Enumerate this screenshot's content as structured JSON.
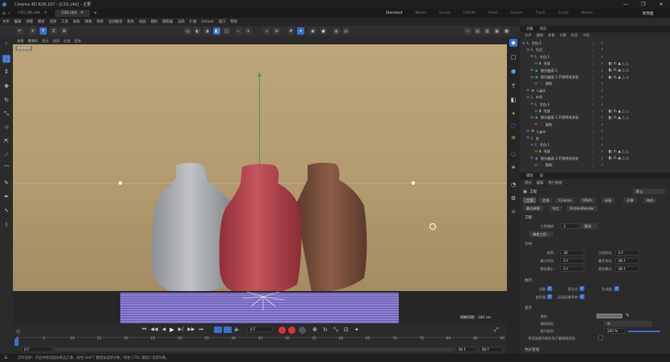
{
  "app": {
    "title": "Cinema 4D R26.107 - [C02.c4d] - 主要"
  },
  "doc_tabs": [
    {
      "label": "C05_Q6.c4d",
      "active": false
    },
    {
      "label": "C02.c4d",
      "active": true
    }
  ],
  "layouts": [
    "Standard",
    "Model",
    "Sculpt",
    "UVEdit",
    "Paint",
    "Groom",
    "Track",
    "Script",
    "Nodes"
  ],
  "active_layout": "Standard",
  "new_layout_label": "新界面",
  "menu": [
    "文件",
    "编辑",
    "创建",
    "模式",
    "选择",
    "工具",
    "样条",
    "网格",
    "体积",
    "运动图形",
    "角色",
    "动画",
    "模拟",
    "跟踪器",
    "渲染",
    "扩展",
    "Octane",
    "窗口",
    "帮助"
  ],
  "viewport_menu": [
    "查看",
    "摄像机",
    "显示",
    "选项",
    "过滤",
    "面板"
  ],
  "viewport_label": "透视视图",
  "viewport_status": "网格间距：100 cm",
  "timeline": {
    "ticks": [
      "0",
      "5",
      "10",
      "15",
      "20",
      "25",
      "30",
      "35",
      "40",
      "45",
      "50",
      "55",
      "60",
      "65",
      "70",
      "75",
      "80",
      "85",
      "90"
    ],
    "current_frame": "0 F",
    "start_frame": "0 F",
    "end_frame_a": "90 F",
    "end_frame_b": "90 F",
    "frame_counter": "0 F"
  },
  "status_text": "实时选择：点击并拖动鼠标框选元素。按住 SHIFT 键增加选择对象；按住 CTRL 键减少选择对象。",
  "object_manager": {
    "tabs": [
      "对象",
      "场次"
    ],
    "menu": [
      "文件",
      "编辑",
      "查看",
      "对象",
      "标签",
      "书签"
    ],
    "rows": [
      {
        "indent": 0,
        "name": "空白.1",
        "icon": "null"
      },
      {
        "indent": 1,
        "name": "左边",
        "icon": "null"
      },
      {
        "indent": 2,
        "name": "空白.1",
        "icon": "null"
      },
      {
        "indent": 3,
        "name": "毛皮",
        "icon": "fur"
      },
      {
        "indent": 2,
        "name": "细分曲面.1",
        "icon": "subdiv"
      },
      {
        "indent": 2,
        "name": "细分曲面.1.不透明毛发贴",
        "icon": "subdiv"
      },
      {
        "indent": 3,
        "name": "圆角",
        "icon": "cube"
      },
      {
        "indent": 1,
        "name": "Light",
        "icon": "light"
      },
      {
        "indent": 1,
        "name": "中间",
        "icon": "null"
      },
      {
        "indent": 2,
        "name": "空白.1",
        "icon": "null"
      },
      {
        "indent": 3,
        "name": "毛皮",
        "icon": "fur"
      },
      {
        "indent": 2,
        "name": "细分曲面.1.不透明毛发贴",
        "icon": "subdiv"
      },
      {
        "indent": 3,
        "name": "圆角",
        "icon": "cube"
      },
      {
        "indent": 1,
        "name": "Light",
        "icon": "light"
      },
      {
        "indent": 1,
        "name": "右",
        "icon": "null"
      },
      {
        "indent": 2,
        "name": "空白.1",
        "icon": "null"
      },
      {
        "indent": 3,
        "name": "毛皮",
        "icon": "fur"
      },
      {
        "indent": 2,
        "name": "细分曲面.1.不透明毛发贴",
        "icon": "subdiv"
      },
      {
        "indent": 3,
        "name": "圆角",
        "icon": "cube"
      }
    ]
  },
  "attribute_manager": {
    "tabs": [
      "属性",
      "层"
    ],
    "menu": [
      "模式",
      "编辑",
      "用户数据"
    ],
    "header_label": "工程",
    "header_dropdown": "默认",
    "section_tabs": [
      "工程",
      "信息",
      "Cinema",
      "XRefs",
      "动画",
      "子弹",
      "待办"
    ],
    "section_tabs2": [
      "静态参数",
      "节点",
      "OctaneRender"
    ],
    "title": "工程",
    "project_scale_label": "工程缩放",
    "project_scale_value": "1",
    "project_scale_unit": "厘米",
    "scale_project_btn": "缩放工程...",
    "timing_section": "计时",
    "fps_label": "帧率",
    "fps_value": "30",
    "project_time_label": "工程时长",
    "project_time_value": "0 F",
    "min_time_label": "最小时长",
    "min_time_value": "0 F",
    "max_time_label": "最大时长",
    "max_time_value": "90 F",
    "preview_min_label": "预览最小",
    "preview_min_value": "0 F",
    "preview_max_label": "预览最大",
    "preview_max_value": "90 F",
    "exec_section": "执行",
    "anim_label": "动画",
    "expr_label": "表达式",
    "gen_label": "生成器",
    "deform_label": "变形器",
    "motion_label": "运动剪辑系统",
    "display_section": "显示",
    "color_label": "颜色",
    "view_clip_label": "视图修剪",
    "view_clip_value": "中",
    "lod_label": "细节级别",
    "lod_value": "100 %",
    "render_lod_label": "将渲染细节级别用于编辑器渲染",
    "color_mgmt_section": "色彩管理"
  },
  "colors": {
    "accent": "#3b6fd0",
    "viewport_bg": "#b39b70",
    "bottle_grey": "#a4a7aa",
    "bottle_red": "#b3474f",
    "bottle_brown": "#7a4f3d",
    "floor_plane": "#7d6fc2"
  }
}
